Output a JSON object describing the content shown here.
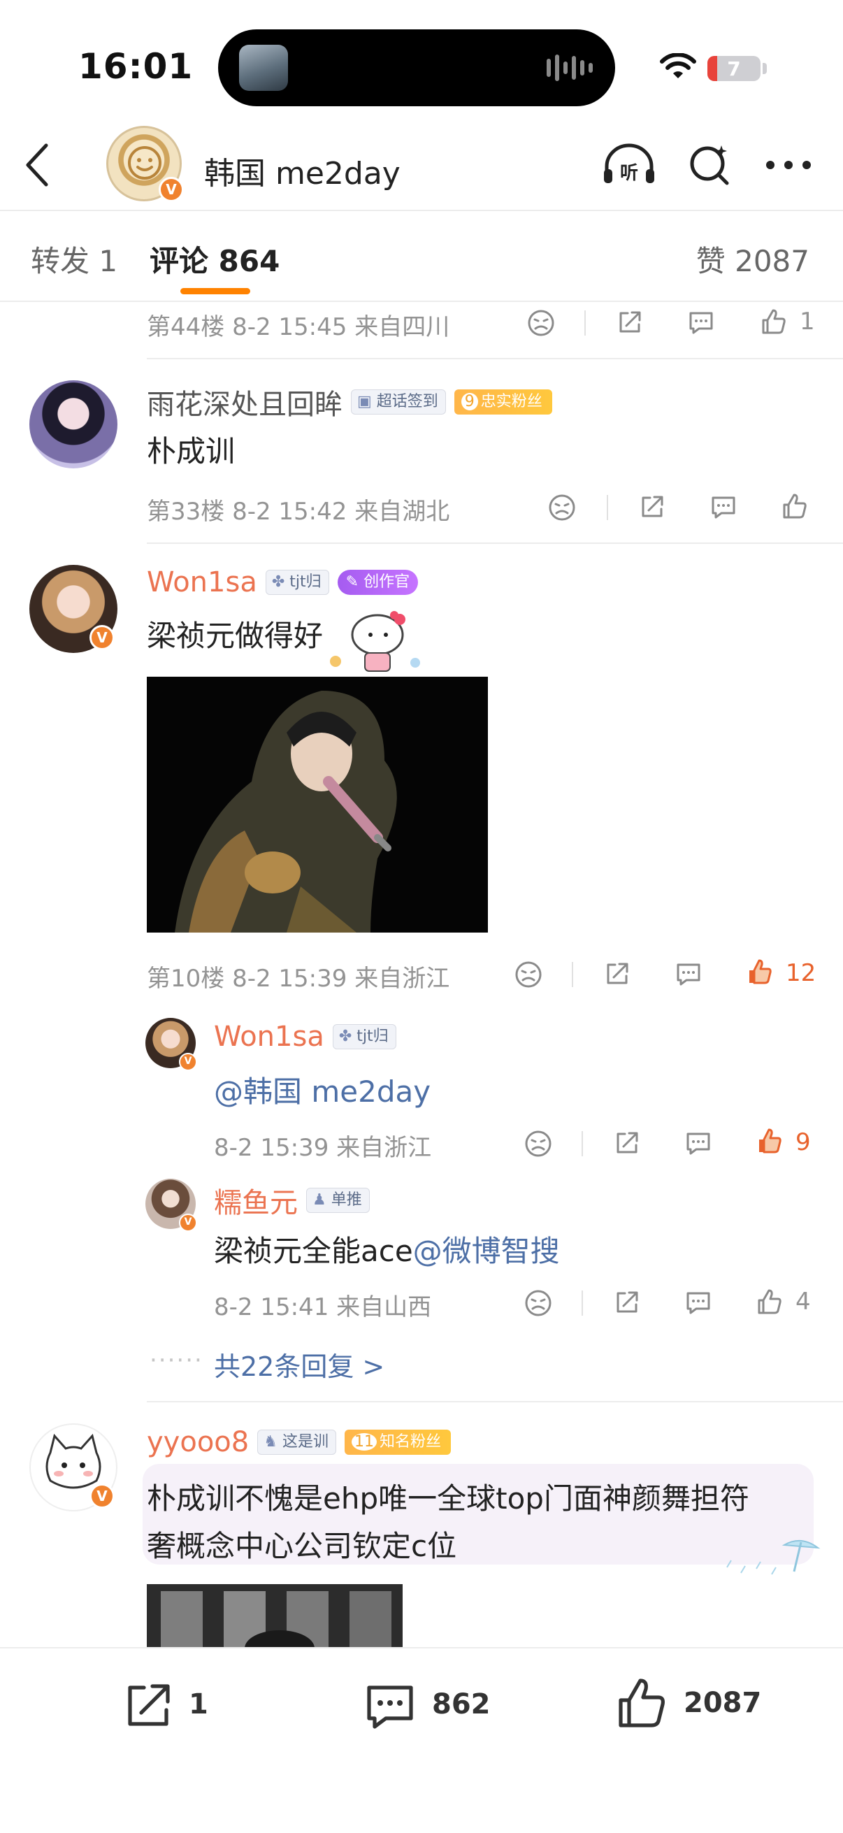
{
  "status_bar": {
    "time": "16:01",
    "battery": "7",
    "battery_level": 0.07
  },
  "header": {
    "title": "韩国 me2day",
    "verified": "V"
  },
  "tabs": {
    "repost": "转发 1",
    "comments": "评论 864",
    "likes": "赞 2087"
  },
  "comments": [
    {
      "floor_meta": "第44楼 8-2 15:45 来自四川",
      "like_count": "1"
    },
    {
      "username": "雨花深处且回眸",
      "badge1": "超话签到",
      "badge2_level": "9",
      "badge2": "忠实粉丝",
      "text": "朴成训",
      "floor_meta": "第33楼 8-2 15:42 来自湖北",
      "like_count": ""
    },
    {
      "username": "Won1sa",
      "badge1": "tjt归",
      "badge2": "创作官",
      "text": "梁祯元做得好",
      "floor_meta": "第10楼 8-2 15:39 来自浙江",
      "like_count": "12",
      "replies": [
        {
          "username": "Won1sa",
          "badge": "tjt归",
          "text": "@韩国 me2day",
          "meta": "8-2 15:39 来自浙江",
          "like_count": "9"
        },
        {
          "username": "糯鱼元",
          "badge": "单推",
          "text_prefix": "梁祯元全能ace",
          "text_mention": "@微博智搜",
          "meta": "8-2 15:41 来自山西",
          "like_count": "4"
        }
      ],
      "more_replies": "共22条回复 >"
    },
    {
      "username": "yyooo8",
      "badge1": "这是训",
      "badge2_level": "11",
      "badge2": "知名粉丝",
      "text_line1": "朴成训不愧是ehp唯一全球top门面神颜舞担符",
      "text_line2": "奢概念中心公司钦定c位"
    }
  ],
  "bottom_bar": {
    "repost_count": "1",
    "comment_count": "862",
    "like_count": "2087"
  },
  "colors": {
    "accent": "#ff8200",
    "username_orange": "#eb7350",
    "link_blue": "#4d6fa6",
    "like_hot": "#e8622c",
    "meta_gray": "#939393"
  }
}
